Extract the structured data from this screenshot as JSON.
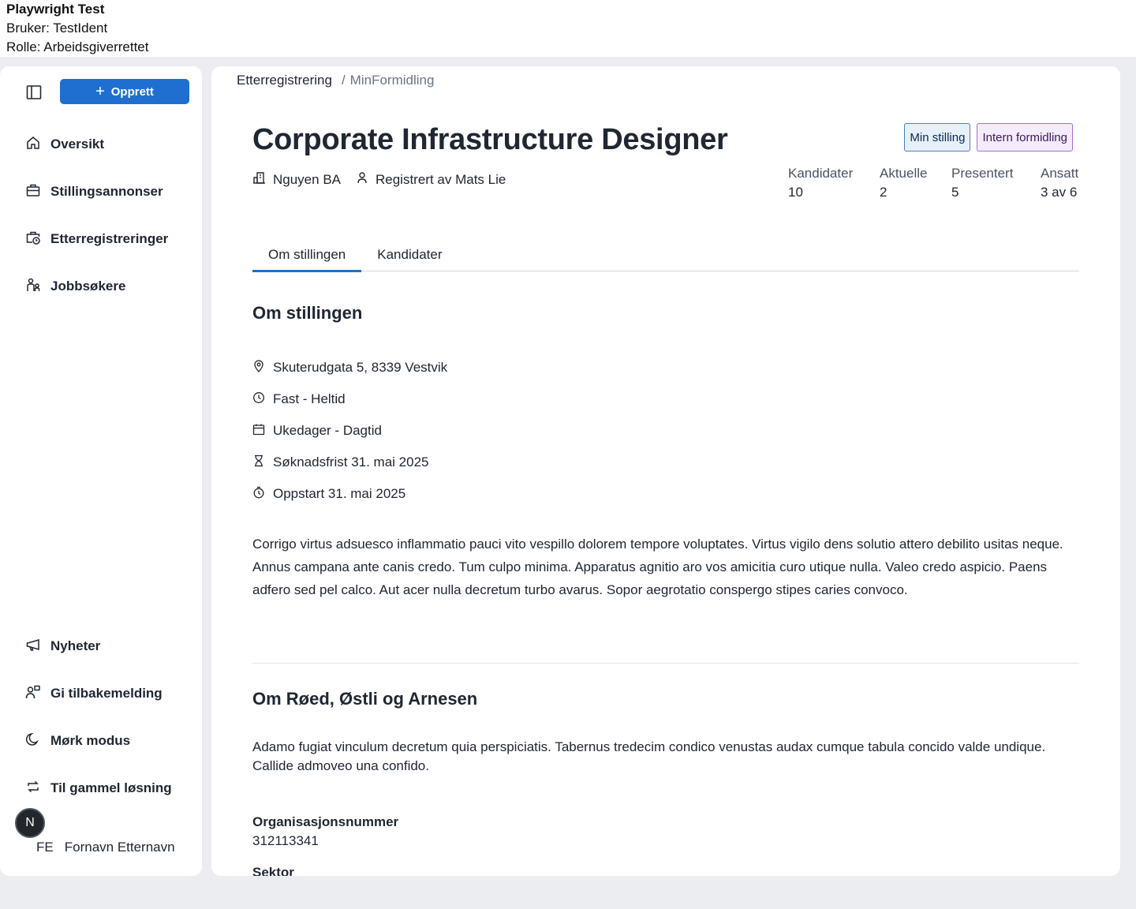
{
  "devbar": {
    "title": "Playwright Test",
    "user": "Bruker: TestIdent",
    "role": "Rolle: Arbeidsgiverrettet"
  },
  "sidebar": {
    "create_label": "Opprett",
    "nav_top": [
      {
        "label": "Oversikt",
        "icon": "house-icon"
      },
      {
        "label": "Stillingsannonser",
        "icon": "briefcase-icon"
      },
      {
        "label": "Etterregistreringer",
        "icon": "briefcase-clock-icon"
      },
      {
        "label": "Jobbsøkere",
        "icon": "people-icon"
      }
    ],
    "nav_bottom": [
      {
        "label": "Nyheter",
        "icon": "megaphone-icon"
      },
      {
        "label": "Gi tilbakemelding",
        "icon": "feedback-icon"
      },
      {
        "label": "Mørk modus",
        "icon": "moon-icon"
      },
      {
        "label": "Til gammel løsning",
        "icon": "arrows-circle-icon"
      }
    ],
    "avatar_letter": "N",
    "user_initials": "FE",
    "user_name": "Fornavn Etternavn"
  },
  "breadcrumb": {
    "link": "Etterregistrering",
    "separator": "/",
    "current": "MinFormidling"
  },
  "job": {
    "title": "Corporate Infrastructure Designer",
    "employer": "Nguyen BA",
    "registered_by": "Registrert av Mats Lie",
    "tags": [
      "Min stilling",
      "Intern formidling"
    ],
    "stats": [
      {
        "label": "Kandidater",
        "value": "10"
      },
      {
        "label": "Aktuelle",
        "value": "2"
      },
      {
        "label": "Presentert",
        "value": "5"
      },
      {
        "label": "Ansatt",
        "value": "3 av 6"
      }
    ]
  },
  "tabs": [
    "Om stillingen",
    "Kandidater"
  ],
  "about": {
    "heading": "Om stillingen",
    "details": [
      {
        "icon": "location-pin-icon",
        "text": "Skuterudgata 5, 8339 Vestvik"
      },
      {
        "icon": "clock-icon",
        "text": "Fast - Heltid"
      },
      {
        "icon": "calendar-icon",
        "text": "Ukedager - Dagtid"
      },
      {
        "icon": "hourglass-icon",
        "text": "Søknadsfrist 31. mai 2025"
      },
      {
        "icon": "stopwatch-icon",
        "text": "Oppstart 31. mai 2025"
      }
    ],
    "description": "Corrigo virtus adsuesco inflammatio pauci vito vespillo dolorem tempore voluptates. Virtus vigilo dens solutio attero debilito usitas neque. Annus campana ante canis credo. Tum culpo minima. Apparatus agnitio aro vos amicitia curo utique nulla. Valeo credo aspicio. Paens adfero sed pel calco. Aut acer nulla decretum turbo avarus. Sopor aegrotatio conspergo stipes caries convoco."
  },
  "company": {
    "heading": "Om Røed, Østli og Arnesen",
    "description": "Adamo fugiat vinculum decretum quia perspiciatis. Tabernus tredecim condico venustas audax cumque tabula concido valde undique. Callide admoveo una confido.",
    "org_label": "Organisasjonsnummer",
    "org_value": "312113341",
    "sector_label": "Sektor"
  }
}
